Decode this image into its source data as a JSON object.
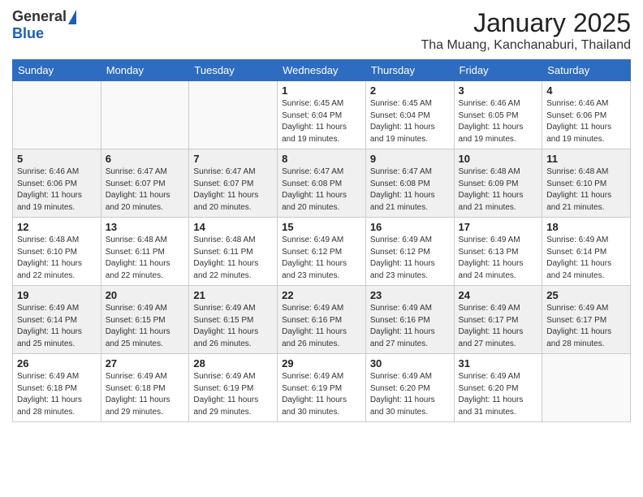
{
  "header": {
    "logo_general": "General",
    "logo_blue": "Blue",
    "month_title": "January 2025",
    "location": "Tha Muang, Kanchanaburi, Thailand"
  },
  "days_of_week": [
    "Sunday",
    "Monday",
    "Tuesday",
    "Wednesday",
    "Thursday",
    "Friday",
    "Saturday"
  ],
  "weeks": [
    [
      {
        "day": "",
        "info": ""
      },
      {
        "day": "",
        "info": ""
      },
      {
        "day": "",
        "info": ""
      },
      {
        "day": "1",
        "info": "Sunrise: 6:45 AM\nSunset: 6:04 PM\nDaylight: 11 hours and 19 minutes."
      },
      {
        "day": "2",
        "info": "Sunrise: 6:45 AM\nSunset: 6:04 PM\nDaylight: 11 hours and 19 minutes."
      },
      {
        "day": "3",
        "info": "Sunrise: 6:46 AM\nSunset: 6:05 PM\nDaylight: 11 hours and 19 minutes."
      },
      {
        "day": "4",
        "info": "Sunrise: 6:46 AM\nSunset: 6:06 PM\nDaylight: 11 hours and 19 minutes."
      }
    ],
    [
      {
        "day": "5",
        "info": "Sunrise: 6:46 AM\nSunset: 6:06 PM\nDaylight: 11 hours and 19 minutes."
      },
      {
        "day": "6",
        "info": "Sunrise: 6:47 AM\nSunset: 6:07 PM\nDaylight: 11 hours and 20 minutes."
      },
      {
        "day": "7",
        "info": "Sunrise: 6:47 AM\nSunset: 6:07 PM\nDaylight: 11 hours and 20 minutes."
      },
      {
        "day": "8",
        "info": "Sunrise: 6:47 AM\nSunset: 6:08 PM\nDaylight: 11 hours and 20 minutes."
      },
      {
        "day": "9",
        "info": "Sunrise: 6:47 AM\nSunset: 6:08 PM\nDaylight: 11 hours and 21 minutes."
      },
      {
        "day": "10",
        "info": "Sunrise: 6:48 AM\nSunset: 6:09 PM\nDaylight: 11 hours and 21 minutes."
      },
      {
        "day": "11",
        "info": "Sunrise: 6:48 AM\nSunset: 6:10 PM\nDaylight: 11 hours and 21 minutes."
      }
    ],
    [
      {
        "day": "12",
        "info": "Sunrise: 6:48 AM\nSunset: 6:10 PM\nDaylight: 11 hours and 22 minutes."
      },
      {
        "day": "13",
        "info": "Sunrise: 6:48 AM\nSunset: 6:11 PM\nDaylight: 11 hours and 22 minutes."
      },
      {
        "day": "14",
        "info": "Sunrise: 6:48 AM\nSunset: 6:11 PM\nDaylight: 11 hours and 22 minutes."
      },
      {
        "day": "15",
        "info": "Sunrise: 6:49 AM\nSunset: 6:12 PM\nDaylight: 11 hours and 23 minutes."
      },
      {
        "day": "16",
        "info": "Sunrise: 6:49 AM\nSunset: 6:12 PM\nDaylight: 11 hours and 23 minutes."
      },
      {
        "day": "17",
        "info": "Sunrise: 6:49 AM\nSunset: 6:13 PM\nDaylight: 11 hours and 24 minutes."
      },
      {
        "day": "18",
        "info": "Sunrise: 6:49 AM\nSunset: 6:14 PM\nDaylight: 11 hours and 24 minutes."
      }
    ],
    [
      {
        "day": "19",
        "info": "Sunrise: 6:49 AM\nSunset: 6:14 PM\nDaylight: 11 hours and 25 minutes."
      },
      {
        "day": "20",
        "info": "Sunrise: 6:49 AM\nSunset: 6:15 PM\nDaylight: 11 hours and 25 minutes."
      },
      {
        "day": "21",
        "info": "Sunrise: 6:49 AM\nSunset: 6:15 PM\nDaylight: 11 hours and 26 minutes."
      },
      {
        "day": "22",
        "info": "Sunrise: 6:49 AM\nSunset: 6:16 PM\nDaylight: 11 hours and 26 minutes."
      },
      {
        "day": "23",
        "info": "Sunrise: 6:49 AM\nSunset: 6:16 PM\nDaylight: 11 hours and 27 minutes."
      },
      {
        "day": "24",
        "info": "Sunrise: 6:49 AM\nSunset: 6:17 PM\nDaylight: 11 hours and 27 minutes."
      },
      {
        "day": "25",
        "info": "Sunrise: 6:49 AM\nSunset: 6:17 PM\nDaylight: 11 hours and 28 minutes."
      }
    ],
    [
      {
        "day": "26",
        "info": "Sunrise: 6:49 AM\nSunset: 6:18 PM\nDaylight: 11 hours and 28 minutes."
      },
      {
        "day": "27",
        "info": "Sunrise: 6:49 AM\nSunset: 6:18 PM\nDaylight: 11 hours and 29 minutes."
      },
      {
        "day": "28",
        "info": "Sunrise: 6:49 AM\nSunset: 6:19 PM\nDaylight: 11 hours and 29 minutes."
      },
      {
        "day": "29",
        "info": "Sunrise: 6:49 AM\nSunset: 6:19 PM\nDaylight: 11 hours and 30 minutes."
      },
      {
        "day": "30",
        "info": "Sunrise: 6:49 AM\nSunset: 6:20 PM\nDaylight: 11 hours and 30 minutes."
      },
      {
        "day": "31",
        "info": "Sunrise: 6:49 AM\nSunset: 6:20 PM\nDaylight: 11 hours and 31 minutes."
      },
      {
        "day": "",
        "info": ""
      }
    ]
  ]
}
